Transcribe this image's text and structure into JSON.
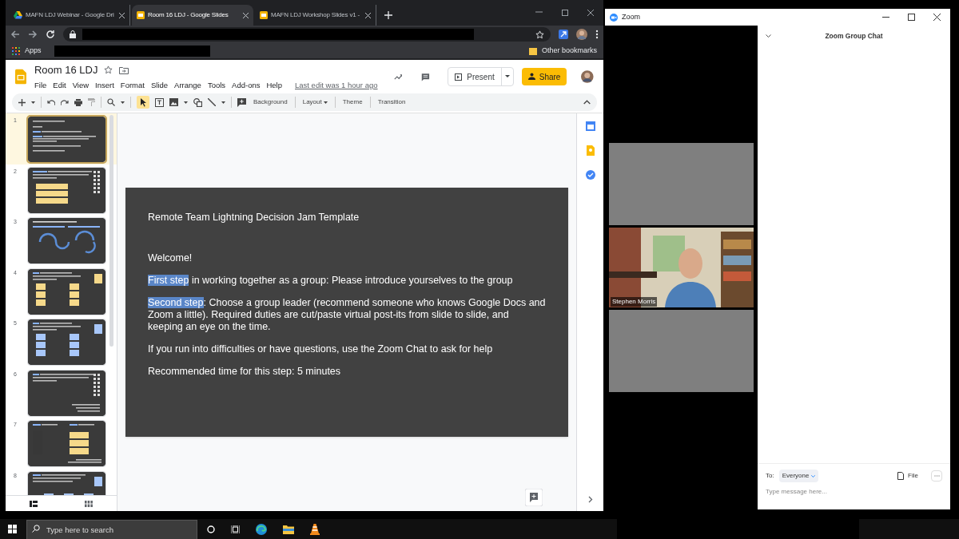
{
  "browser": {
    "tabs": [
      {
        "title": "MAFN LDJ Webinar - Google Dri",
        "kind": "drive",
        "selected": false
      },
      {
        "title": "Room 16 LDJ - Google Slides",
        "kind": "slides",
        "selected": true
      },
      {
        "title": "MAFN LDJ Workshop Slides v1 -",
        "kind": "slides",
        "selected": false
      }
    ],
    "apps": "Apps",
    "other_bookmarks": "Other bookmarks"
  },
  "slides_app": {
    "doc_title": "Room 16 LDJ",
    "menu": [
      "File",
      "Edit",
      "View",
      "Insert",
      "Format",
      "Slide",
      "Arrange",
      "Tools",
      "Add-ons",
      "Help"
    ],
    "last_edit": "Last edit was 1 hour ago",
    "present": "Present",
    "share": "Share",
    "toolbar_buttons": [
      {
        "label": "Background",
        "dropdown": false
      },
      {
        "label": "Layout",
        "dropdown": true
      },
      {
        "label": "Theme",
        "dropdown": false
      },
      {
        "label": "Transition",
        "dropdown": false
      }
    ],
    "filmstrip": [
      {
        "number": "1",
        "kind": "text",
        "selected": true
      },
      {
        "number": "2",
        "kind": "notes",
        "selected": false
      },
      {
        "number": "3",
        "kind": "cycle",
        "selected": false
      },
      {
        "number": "4",
        "kind": "yellow-grid",
        "selected": false
      },
      {
        "number": "5",
        "kind": "blue-grid",
        "selected": false
      },
      {
        "number": "6",
        "kind": "text-only",
        "selected": false
      },
      {
        "number": "7",
        "kind": "mixed",
        "selected": false
      },
      {
        "number": "8",
        "kind": "blue-row",
        "selected": false
      }
    ],
    "slide": {
      "title": "Remote Team Lightning Decision Jam Template",
      "paragraphs": [
        {
          "text": "Welcome!"
        },
        {
          "highlight": "First step",
          "text": " in working together as a group: Please introduce yourselves to the group"
        },
        {
          "highlight": "Second step",
          "text": ": Choose a group leader (recommend someone who knows Google Docs and Zoom a little). Required duties are cut/paste virtual post-its from slide to slide, and keeping an eye on the time."
        },
        {
          "text": "If you run into difficulties or have questions, use the Zoom Chat to ask for help"
        },
        {
          "text": "Recommended time for this step: 5 minutes"
        }
      ]
    }
  },
  "zoom": {
    "title": "Zoom",
    "chat_title": "Zoom Group Chat",
    "participants": [
      {
        "kind": "empty"
      },
      {
        "kind": "video",
        "name": "Stephen Morris"
      },
      {
        "kind": "empty"
      }
    ],
    "to_label": "To:",
    "recipient": "Everyone",
    "file": "File",
    "message_placeholder": "Type message here..."
  },
  "taskbar": {
    "search_placeholder": "Type here to search"
  }
}
